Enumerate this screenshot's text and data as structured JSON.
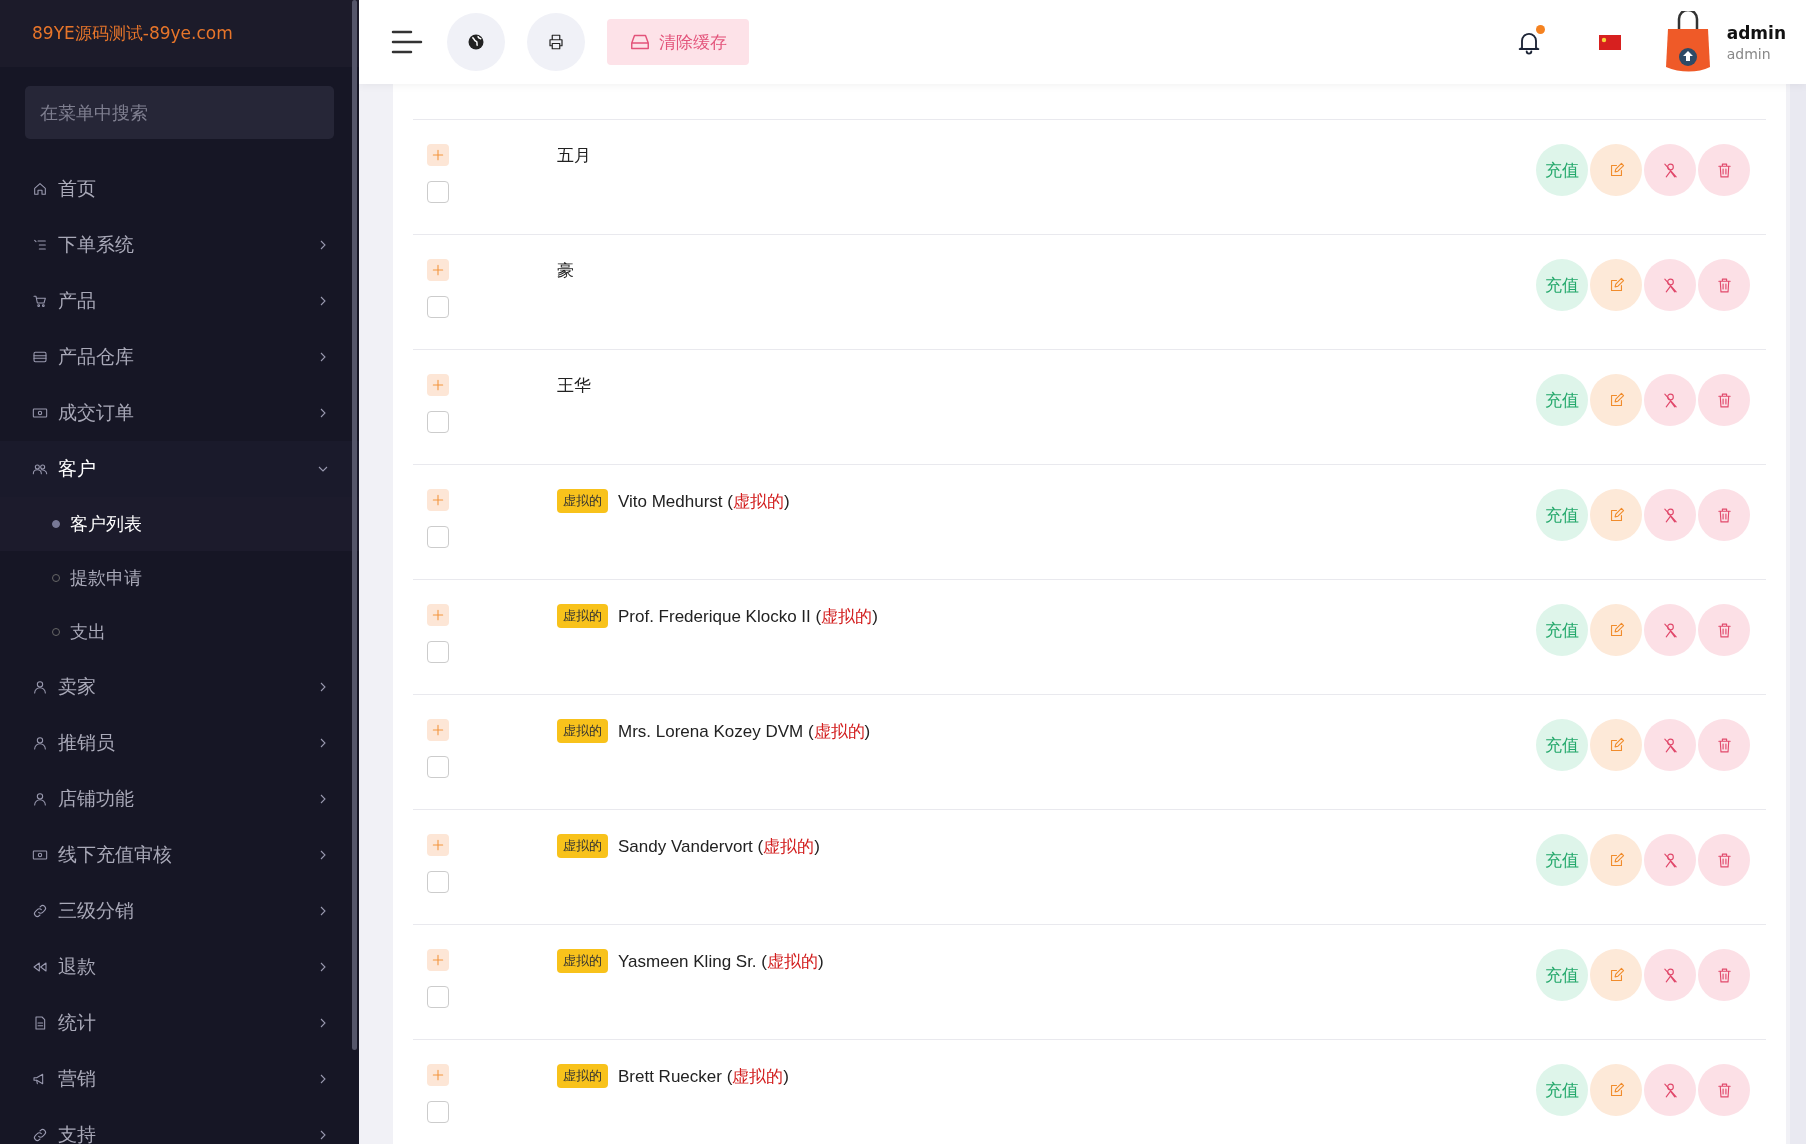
{
  "brand": "89YE源码测试-89ye.com",
  "sidebar": {
    "search": {
      "placeholder": "在菜单中搜索"
    },
    "items": [
      {
        "label": "首页",
        "expanded": false,
        "has_children": false
      },
      {
        "label": "下单系统",
        "expanded": false,
        "has_children": true
      },
      {
        "label": "产品",
        "expanded": false,
        "has_children": true
      },
      {
        "label": "产品仓库",
        "expanded": false,
        "has_children": true
      },
      {
        "label": "成交订单",
        "expanded": false,
        "has_children": true
      },
      {
        "label": "客户",
        "expanded": true,
        "has_children": true,
        "children": [
          {
            "label": "客户列表",
            "selected": true
          },
          {
            "label": "提款申请",
            "selected": false
          },
          {
            "label": "支出",
            "selected": false
          }
        ]
      },
      {
        "label": "卖家",
        "expanded": false,
        "has_children": true
      },
      {
        "label": "推销员",
        "expanded": false,
        "has_children": true
      },
      {
        "label": "店铺功能",
        "expanded": false,
        "has_children": true
      },
      {
        "label": "线下充值审核",
        "expanded": false,
        "has_children": true
      },
      {
        "label": "三级分销",
        "expanded": false,
        "has_children": true
      },
      {
        "label": "退款",
        "expanded": false,
        "has_children": true
      },
      {
        "label": "统计",
        "expanded": false,
        "has_children": true
      },
      {
        "label": "营销",
        "expanded": false,
        "has_children": true
      },
      {
        "label": "支持",
        "expanded": false,
        "has_children": true
      }
    ]
  },
  "header": {
    "clear_cache": "清除缓存",
    "notification": true,
    "user": {
      "name": "admin",
      "role": "admin"
    }
  },
  "rows": [
    {
      "checked": false,
      "name": "五月",
      "recharge": "充值"
    },
    {
      "checked": false,
      "name": "豪",
      "recharge": "充值"
    },
    {
      "checked": false,
      "name": "王华",
      "recharge": "充值"
    },
    {
      "checked": false,
      "tag": "虚拟的",
      "name": "Vito Medhurst",
      "note": {
        "open": "(",
        "text": "虚拟的",
        "close": ")"
      },
      "recharge": "充值"
    },
    {
      "checked": false,
      "tag": "虚拟的",
      "name": "Prof. Frederique Klocko II",
      "note": {
        "open": "(",
        "text": "虚拟的",
        "close": ")"
      },
      "recharge": "充值"
    },
    {
      "checked": false,
      "tag": "虚拟的",
      "name": "Mrs. Lorena Kozey DVM",
      "note": {
        "open": "(",
        "text": "虚拟的",
        "close": ")"
      },
      "recharge": "充值"
    },
    {
      "checked": false,
      "tag": "虚拟的",
      "name": "Sandy Vandervort",
      "note": {
        "open": "(",
        "text": "虚拟的",
        "close": ")"
      },
      "recharge": "充值"
    },
    {
      "checked": false,
      "tag": "虚拟的",
      "name": "Yasmeen Kling Sr.",
      "note": {
        "open": "(",
        "text": "虚拟的",
        "close": ")"
      },
      "recharge": "充值"
    },
    {
      "checked": false,
      "tag": "虚拟的",
      "name": "Brett Ruecker",
      "note": {
        "open": "(",
        "text": "虚拟的",
        "close": ")"
      },
      "recharge": "充值"
    }
  ]
}
